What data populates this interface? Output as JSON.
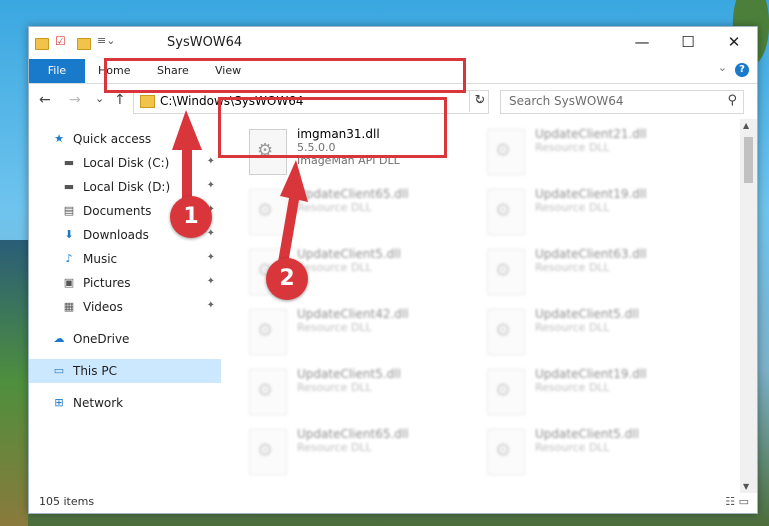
{
  "window": {
    "title": "SysWOW64",
    "minimize_glyph": "—",
    "maximize_glyph": "☐",
    "close_glyph": "✕"
  },
  "ribbon": {
    "tabs": [
      "File",
      "Home",
      "Share",
      "View"
    ],
    "help": "?",
    "collapse_glyph": "⌄"
  },
  "navigation": {
    "back_glyph": "←",
    "forward_glyph": "→",
    "recent_glyph": "⌄",
    "up_glyph": "↑",
    "address_path": "C:\\Windows\\SysWOW64",
    "address_dropdown_glyph": "⌄",
    "refresh_glyph": "↻",
    "search_placeholder": "Search SysWOW64",
    "search_glyph": "⚲"
  },
  "sidebar": {
    "items": [
      {
        "label": "Quick access",
        "icon": "star-icon",
        "glyph": "★",
        "pinned": false
      },
      {
        "label": "Local Disk (C:)",
        "icon": "drive-icon",
        "glyph": "▬",
        "pinned": true
      },
      {
        "label": "Local Disk (D:)",
        "icon": "drive-icon",
        "glyph": "▬",
        "pinned": true
      },
      {
        "label": "Documents",
        "icon": "document-icon",
        "glyph": "▤",
        "pinned": true
      },
      {
        "label": "Downloads",
        "icon": "download-icon",
        "glyph": "⬇",
        "pinned": true
      },
      {
        "label": "Music",
        "icon": "music-icon",
        "glyph": "♪",
        "pinned": true
      },
      {
        "label": "Pictures",
        "icon": "pictures-icon",
        "glyph": "▣",
        "pinned": true
      },
      {
        "label": "Videos",
        "icon": "video-icon",
        "glyph": "▦",
        "pinned": true
      },
      {
        "label": "OneDrive",
        "icon": "cloud-icon",
        "glyph": "☁",
        "pinned": false
      },
      {
        "label": "This PC",
        "icon": "computer-icon",
        "glyph": "▭",
        "pinned": false
      },
      {
        "label": "Network",
        "icon": "network-icon",
        "glyph": "⊞",
        "pinned": false
      }
    ],
    "pin_glyph": "✦"
  },
  "files": [
    {
      "name": "imgman31.dll",
      "version": "5.5.0.0",
      "type": "ImageMan API DLL",
      "highlighted": true
    },
    {
      "name": "UpdateClient21.dll",
      "version": "",
      "type": "Resource DLL",
      "highlighted": false
    },
    {
      "name": "UpdateClient65.dll",
      "version": "",
      "type": "Resource DLL",
      "highlighted": false
    },
    {
      "name": "UpdateClient19.dll",
      "version": "",
      "type": "Resource DLL",
      "highlighted": false
    },
    {
      "name": "UpdateClient5.dll",
      "version": "",
      "type": "Resource DLL",
      "highlighted": false
    },
    {
      "name": "UpdateClient63.dll",
      "version": "",
      "type": "Resource DLL",
      "highlighted": false
    },
    {
      "name": "UpdateClient42.dll",
      "version": "",
      "type": "Resource DLL",
      "highlighted": false
    },
    {
      "name": "UpdateClient5.dll",
      "version": "",
      "type": "Resource DLL",
      "highlighted": false
    },
    {
      "name": "UpdateClient5.dll",
      "version": "",
      "type": "Resource DLL",
      "highlighted": false
    },
    {
      "name": "UpdateClient19.dll",
      "version": "",
      "type": "Resource DLL",
      "highlighted": false
    },
    {
      "name": "UpdateClient65.dll",
      "version": "",
      "type": "Resource DLL",
      "highlighted": false
    },
    {
      "name": "UpdateClient5.dll",
      "version": "",
      "type": "Resource DLL",
      "highlighted": false
    }
  ],
  "status": {
    "item_count": "105 items",
    "view_glyphs": "☷ ▭"
  },
  "annotations": {
    "marker1": "1",
    "marker2": "2",
    "color": "#d9363c"
  }
}
